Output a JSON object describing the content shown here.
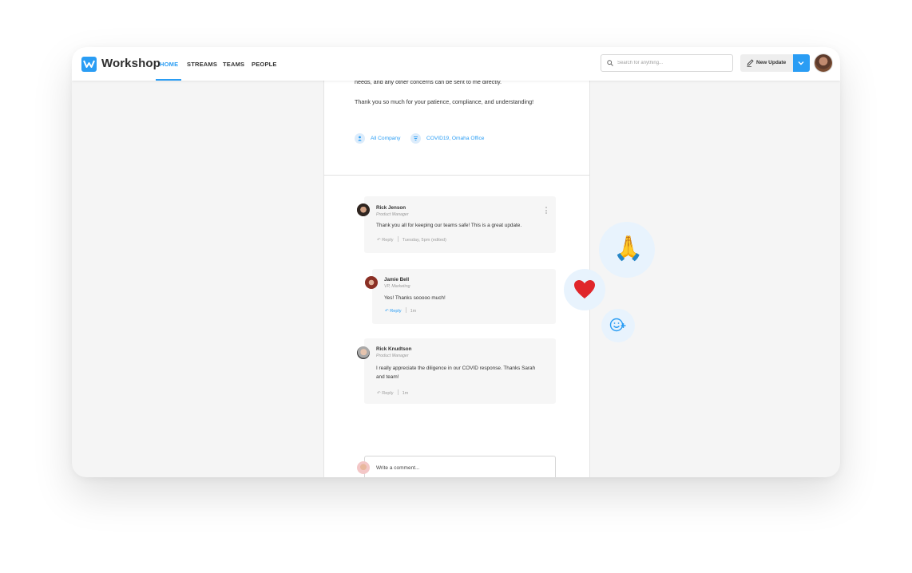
{
  "app": {
    "name": "Workshop"
  },
  "nav": [
    {
      "label": "HOME",
      "active": true
    },
    {
      "label": "STREAMS",
      "active": false
    },
    {
      "label": "TEAMS",
      "active": false
    },
    {
      "label": "PEOPLE",
      "active": false
    }
  ],
  "search": {
    "placeholder": "Search for anything..."
  },
  "toolbar": {
    "new_update_label": "New Update"
  },
  "post": {
    "cut_line": "needs, and any other concerns can be sent to me directly.",
    "thanks_line": "Thank you so much for your patience, compliance, and understanding!",
    "tags": [
      {
        "label": "All Company",
        "icon": "person-icon"
      },
      {
        "label": "COVID19, Omaha Office",
        "icon": "stream-icon"
      }
    ]
  },
  "comments": [
    {
      "name": "Rick Jenson",
      "role": "Product Manager",
      "body": "Thank you all for keeping our teams safe! This is a great update.",
      "reply_label": "Reply",
      "meta": "Tuesday, 5pm (edited)"
    },
    {
      "name": "Jamie Bell",
      "role": "VP, Marketing",
      "body": "Yes! Thanks sooooo much!",
      "reply_label": "Reply",
      "meta": "1m"
    },
    {
      "name": "Rick Knudtson",
      "role": "Product Manager",
      "body_line1": "I really appreciate the diligence in our COVID response. Thanks Sarah",
      "body_line2": "and team!",
      "reply_label": "Reply",
      "meta": "1m"
    }
  ],
  "composer": {
    "placeholder": "Write a comment..."
  },
  "reactions": [
    {
      "emoji": "🙏",
      "name": "folded-hands"
    },
    {
      "emoji": "❤️",
      "name": "heart"
    },
    {
      "name": "add-reaction"
    }
  ],
  "colors": {
    "accent": "#2a9df4",
    "background": "#f5f5f5",
    "panel": "#ffffff"
  }
}
